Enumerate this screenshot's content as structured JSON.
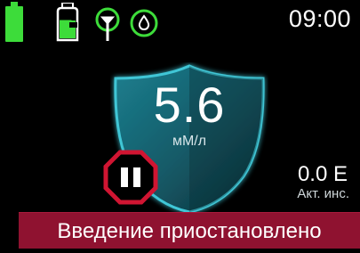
{
  "status_bar": {
    "time": "09:00",
    "icons": [
      "battery-icon",
      "reservoir-icon",
      "antenna-icon",
      "drop-icon"
    ],
    "battery_level": 1.0,
    "accent_color": "#3ddc3a"
  },
  "glucose": {
    "value": "5.6",
    "unit": "мМ/л",
    "shield_color": "#2aa8b8"
  },
  "delivery": {
    "state_icon": "pause-icon",
    "state_color": "#d01532"
  },
  "insulin": {
    "value": "0.0 Е",
    "label": "Акт. инс."
  },
  "banner": {
    "text": "Введение приостановлено",
    "color": "#8f1230"
  }
}
